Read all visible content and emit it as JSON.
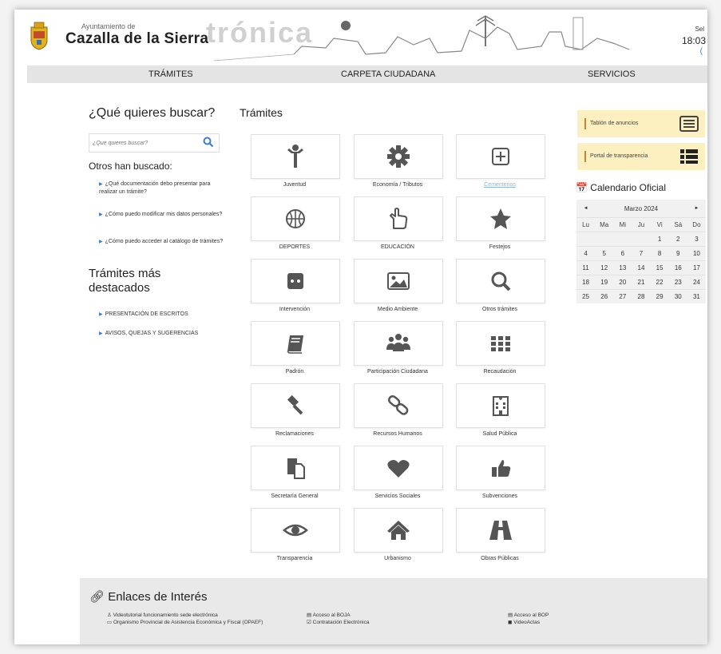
{
  "header": {
    "municipality_small": "Ayuntamiento de",
    "municipality_name": "Cazalla de la Sierra",
    "brand_fragment": "trónica",
    "date_short": "Sel",
    "time": "18:03",
    "time_dot": "("
  },
  "nav": {
    "items": [
      "TRÁMITES",
      "CARPETA CIUDADANA",
      "SERVICIOS"
    ]
  },
  "search": {
    "title": "¿Qué quieres buscar?",
    "placeholder": "¿Qué quieres buscar?",
    "others_title": "Otros han buscado:",
    "suggestions": [
      "¿Qué documentación debo presentar para realizar un trámite?",
      "¿Cómo puedo modificar mis datos personales?",
      "¿Cómo puedo acceder al catálogo de trámites?"
    ]
  },
  "highlights": {
    "title": "Trámites más destacados",
    "items": [
      "PRESENTACIÓN DE ESCRITOS",
      "AVISOS, QUEJAS Y SUGERENCIAS"
    ]
  },
  "tramites": {
    "title": "Trámites",
    "items": [
      {
        "label": "Juventud",
        "icon": "person-icon"
      },
      {
        "label": "Economía / Tributos",
        "icon": "gear-icon"
      },
      {
        "label": "Cementerios",
        "icon": "plus-square-icon"
      },
      {
        "label": "DEPORTES",
        "icon": "basketball-icon"
      },
      {
        "label": "EDUCACIÓN",
        "icon": "pointing-hand-icon"
      },
      {
        "label": "Festejos",
        "icon": "star-icon"
      },
      {
        "label": "Intervención",
        "icon": "dots-icon"
      },
      {
        "label": "Medio Ambiente",
        "icon": "image-icon"
      },
      {
        "label": "Otros trámites",
        "icon": "search-icon"
      },
      {
        "label": "Padrón",
        "icon": "book-icon"
      },
      {
        "label": "Participación Ciudadana",
        "icon": "group-icon"
      },
      {
        "label": "Recaudación",
        "icon": "grid-icon"
      },
      {
        "label": "Reclamaciones",
        "icon": "gavel-icon"
      },
      {
        "label": "Recursos Humanos",
        "icon": "link-icon"
      },
      {
        "label": "Salud Pública",
        "icon": "hospital-icon"
      },
      {
        "label": "Secretaría General",
        "icon": "copy-icon"
      },
      {
        "label": "Servicios Sociales",
        "icon": "heart-icon"
      },
      {
        "label": "Subvenciones",
        "icon": "thumbs-up-icon"
      },
      {
        "label": "Transparencia",
        "icon": "eye-icon"
      },
      {
        "label": "Urbanismo",
        "icon": "home-icon"
      },
      {
        "label": "Obras Públicas",
        "icon": "road-icon"
      }
    ]
  },
  "sidebar": {
    "tablon": "Tablón de anuncios",
    "portal": "Portal de transparencia",
    "calendar_title": "Calendario Oficial",
    "prev": "◄",
    "next": "►",
    "month": "Marzo 2024",
    "weekdays": [
      "Lu",
      "Ma",
      "Mi",
      "Ju",
      "Vi",
      "Sá",
      "Do"
    ],
    "weeks": [
      [
        "",
        "",
        "",
        "",
        "1",
        "2",
        "3"
      ],
      [
        "4",
        "5",
        "6",
        "7",
        "8",
        "9",
        "10"
      ],
      [
        "11",
        "12",
        "13",
        "14",
        "15",
        "16",
        "17"
      ],
      [
        "18",
        "19",
        "20",
        "21",
        "22",
        "23",
        "24"
      ],
      [
        "25",
        "26",
        "27",
        "28",
        "29",
        "30",
        "31"
      ]
    ]
  },
  "footer": {
    "title": "Enlaces de Interés",
    "links": [
      "♙ Videotutorial funcionamiento sede electrónica",
      "▭ Organismo Provincial de Asistencia Económica y Fiscal (OPAEF)",
      "▤ Acceso al BOJA",
      "☑ Contratación Electrónica",
      "▤ Acceso al BOP",
      "◼ VideoActas"
    ]
  },
  "colors": {
    "accent": "#3a7bd5",
    "tile_icon": "#555555",
    "sidebar_button": "#fdf0c0",
    "nav_bg": "#e4e4e4"
  }
}
